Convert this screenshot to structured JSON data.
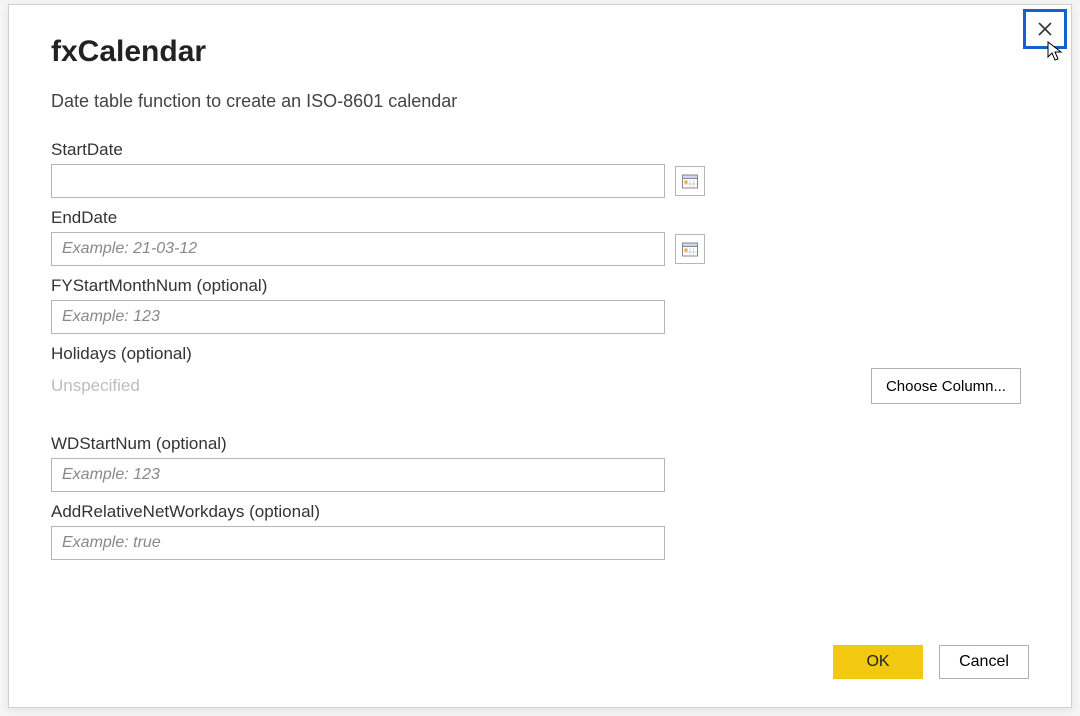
{
  "dialog": {
    "title": "fxCalendar",
    "subtitle": "Date table function to create an ISO-8601 calendar"
  },
  "fields": {
    "startDate": {
      "label": "StartDate",
      "value": "",
      "placeholder": ""
    },
    "endDate": {
      "label": "EndDate",
      "value": "",
      "placeholder": "Example: 21-03-12"
    },
    "fyStartMonthNum": {
      "label": "FYStartMonthNum (optional)",
      "value": "",
      "placeholder": "Example: 123"
    },
    "holidays": {
      "label": "Holidays (optional)",
      "status": "Unspecified",
      "chooseColumnLabel": "Choose Column..."
    },
    "wdStartNum": {
      "label": "WDStartNum (optional)",
      "value": "",
      "placeholder": "Example: 123"
    },
    "addRelativeNetWorkdays": {
      "label": "AddRelativeNetWorkdays (optional)",
      "value": "",
      "placeholder": "Example: true"
    }
  },
  "buttons": {
    "ok": "OK",
    "cancel": "Cancel"
  },
  "colors": {
    "primary": "#f2c811",
    "closeHighlight": "#1a5fd0"
  }
}
